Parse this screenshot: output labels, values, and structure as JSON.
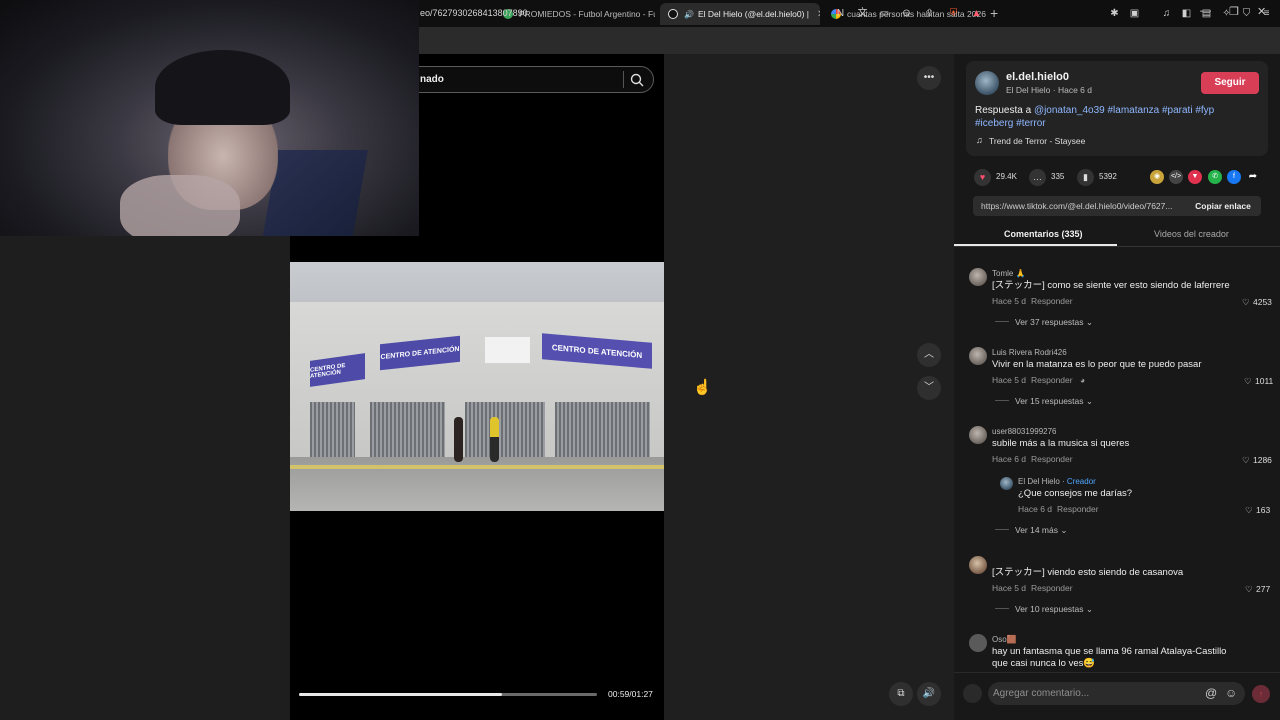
{
  "browser": {
    "tabs": [
      {
        "title": "PROMIEDOS - Futbol Argentino - Fú"
      },
      {
        "title": "El Del Hielo (@el.del.hielo0) |"
      },
      {
        "title": "cuantas personas habitan salta 2026"
      }
    ],
    "new_tab_symbol": "+",
    "url_visible": "eo/7627930268413807890"
  },
  "page": {
    "search_text": "nado"
  },
  "video": {
    "timecode": "00:59/01:27",
    "progress_fraction": 0.68,
    "banners": [
      "CENTRO DE ATENCIÓN",
      "CENTRO DE ATENCIÓN",
      "CENTRO DE ATENCIÓN"
    ],
    "banner_sub": "DELEGACIÓN SAN JUSTO"
  },
  "creator": {
    "username": "el.del.hielo0",
    "subline": "El Del Hielo · Hace 6 d",
    "follow_label": "Seguir",
    "description_prefix": "Respuesta a",
    "mention": "@jonatan_4o39",
    "hashtags_line1": "#lamatanza #parati #fyp",
    "hashtags_line2": "#iceberg #terror",
    "music": "Trend de Terror - Staysee"
  },
  "stats": {
    "likes": "29.4K",
    "comments": "335",
    "saves": "5392"
  },
  "share": {
    "link": "https://www.tiktok.com/@el.del.hielo0/video/7627...",
    "copy_label": "Copiar enlace"
  },
  "panel_tabs": {
    "comments": "Comentarios (335)",
    "creator_videos": "Videos del creador"
  },
  "comments": [
    {
      "user": "Tomle 🙏",
      "text": "[ステッカー] como se siente ver esto siendo de laferrere",
      "time": "Hace 5 d",
      "reply": "Responder",
      "likes": "4253",
      "more": "Ver 37 respuestas"
    },
    {
      "user": "Luis Rivera Rodri426",
      "text": "Vivir en la matanza es lo peor que te puedo pasar",
      "time": "Hace 5 d",
      "reply": "Responder",
      "likes": "1011",
      "more": "Ver 15 respuestas"
    },
    {
      "user": "user88031999276",
      "text": "subile más a la musica si queres",
      "time": "Hace 6 d",
      "reply": "Responder",
      "likes": "1286",
      "more": "Ver 14 más"
    },
    {
      "user": "",
      "text": "[ステッカー] viendo esto siendo de casanova",
      "time": "Hace 5 d",
      "reply": "Responder",
      "likes": "277",
      "more": "Ver 10 respuestas"
    },
    {
      "user": "Oso🟫",
      "text_line1": "hay un fantasma que se llama 96 ramal Atalaya-Castillo",
      "text_line2": "que casi nunca lo ves😅"
    }
  ],
  "creator_reply": {
    "name": "El Del Hielo",
    "tag": "Creador",
    "text": "¿Que consejos me darías?",
    "time": "Hace 6 d",
    "reply": "Responder",
    "likes": "163"
  },
  "composer": {
    "placeholder": "Agregar comentario..."
  }
}
